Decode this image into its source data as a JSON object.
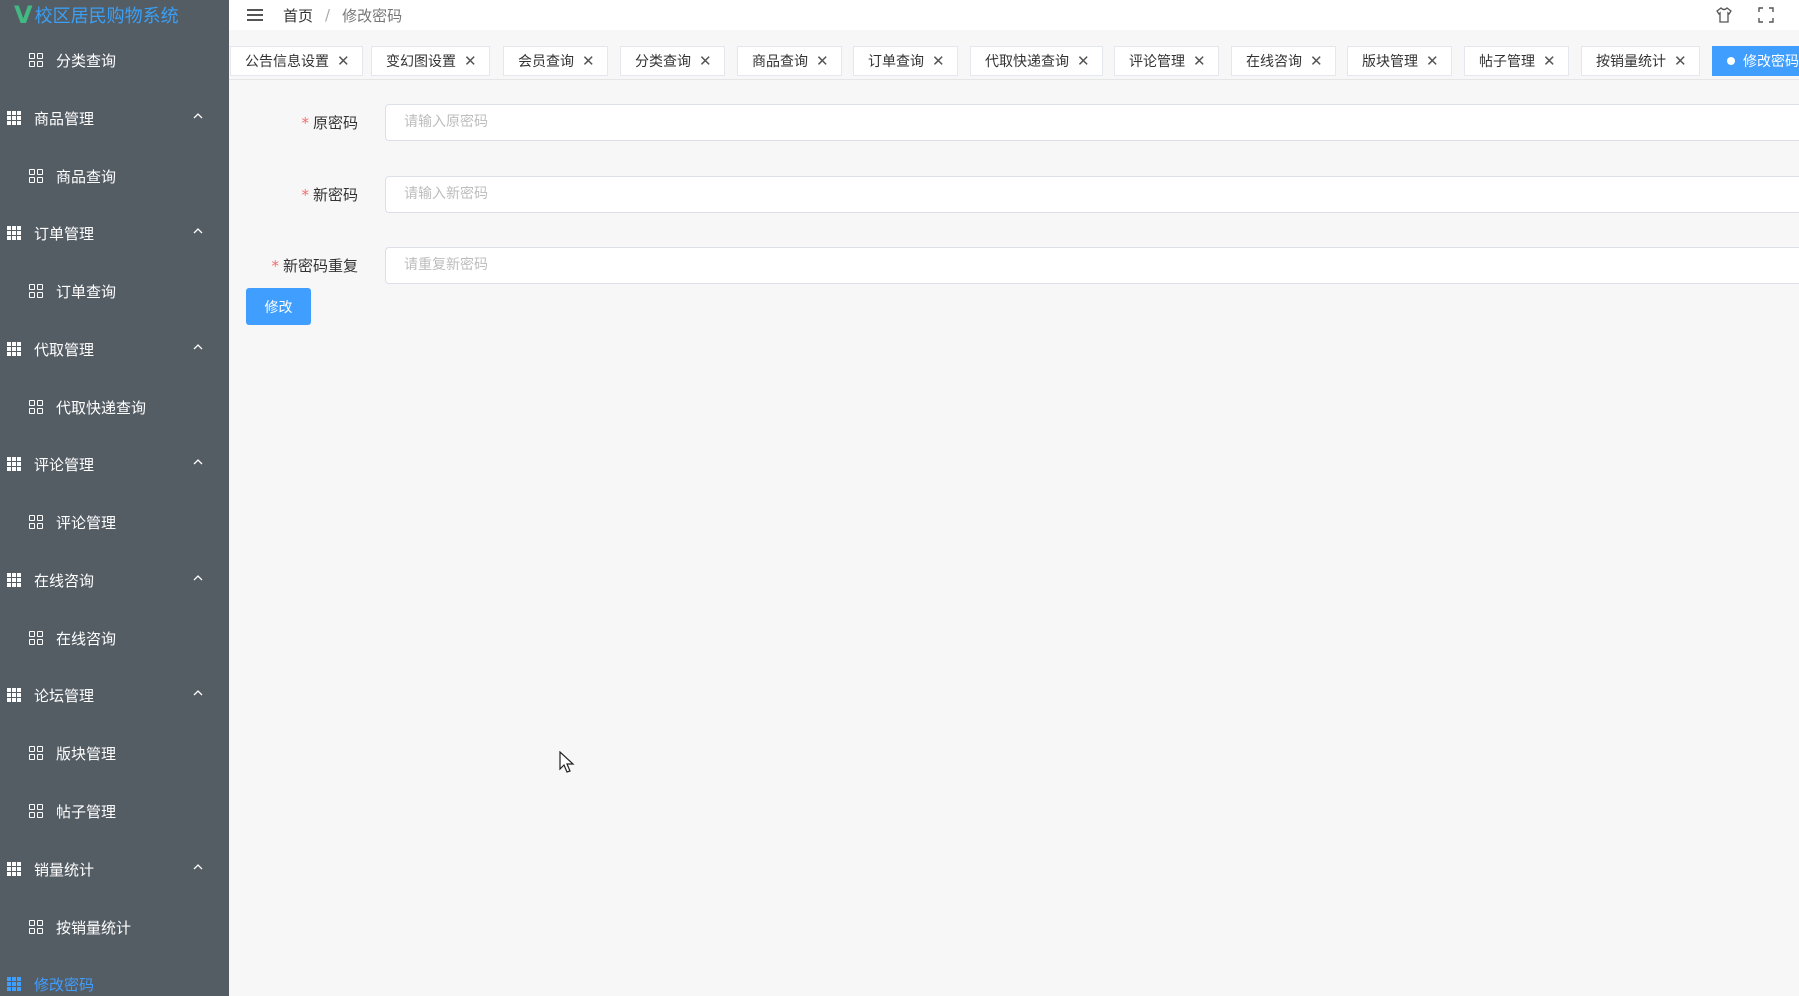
{
  "app": {
    "title": "校区居民购物系统"
  },
  "sidebar": {
    "items": [
      {
        "label": "分类查询",
        "level": "child",
        "icon": "grid-four-icon"
      },
      {
        "label": "商品管理",
        "level": "parent",
        "icon": "table-icon"
      },
      {
        "label": "商品查询",
        "level": "child",
        "icon": "grid-four-icon"
      },
      {
        "label": "订单管理",
        "level": "parent",
        "icon": "table-icon"
      },
      {
        "label": "订单查询",
        "level": "child",
        "icon": "grid-four-icon"
      },
      {
        "label": "代取管理",
        "level": "parent",
        "icon": "table-icon"
      },
      {
        "label": "代取快递查询",
        "level": "child",
        "icon": "grid-four-icon"
      },
      {
        "label": "评论管理",
        "level": "parent",
        "icon": "table-icon"
      },
      {
        "label": "评论管理",
        "level": "child",
        "icon": "grid-four-icon"
      },
      {
        "label": "在线咨询",
        "level": "parent",
        "icon": "table-icon"
      },
      {
        "label": "在线咨询",
        "level": "child",
        "icon": "grid-four-icon"
      },
      {
        "label": "论坛管理",
        "level": "parent",
        "icon": "table-icon"
      },
      {
        "label": "版块管理",
        "level": "child",
        "icon": "grid-four-icon"
      },
      {
        "label": "帖子管理",
        "level": "child",
        "icon": "grid-four-icon"
      },
      {
        "label": "销量统计",
        "level": "parent",
        "icon": "table-icon"
      },
      {
        "label": "按销量统计",
        "level": "child",
        "icon": "grid-four-icon"
      },
      {
        "label": "修改密码",
        "level": "parent",
        "icon": "table-icon",
        "active": true
      }
    ]
  },
  "header": {
    "breadcrumb_home": "首页",
    "breadcrumb_sep": "/",
    "breadcrumb_current": "修改密码"
  },
  "tabs": [
    {
      "label": "公告信息设置",
      "close": "✕"
    },
    {
      "label": "变幻图设置",
      "close": "✕"
    },
    {
      "label": "会员查询",
      "close": "✕"
    },
    {
      "label": "分类查询",
      "close": "✕"
    },
    {
      "label": "商品查询",
      "close": "✕"
    },
    {
      "label": "订单查询",
      "close": "✕"
    },
    {
      "label": "代取快递查询",
      "close": "✕"
    },
    {
      "label": "评论管理",
      "close": "✕"
    },
    {
      "label": "在线咨询",
      "close": "✕"
    },
    {
      "label": "版块管理",
      "close": "✕"
    },
    {
      "label": "帖子管理",
      "close": "✕"
    },
    {
      "label": "按销量统计",
      "close": "✕"
    },
    {
      "label": "修改密码",
      "active": true
    }
  ],
  "form": {
    "old_password": {
      "label": "原密码",
      "placeholder": "请输入原密码",
      "required": "*"
    },
    "new_password": {
      "label": "新密码",
      "placeholder": "请输入新密码",
      "required": "*"
    },
    "repeat_password": {
      "label": "新密码重复",
      "placeholder": "请重复新密码",
      "required": "*"
    },
    "submit_label": "修改"
  },
  "colors": {
    "sidebar_bg": "#545c64",
    "accent": "#409eff",
    "logo_v": "#42b883",
    "required": "#f56c6c"
  }
}
